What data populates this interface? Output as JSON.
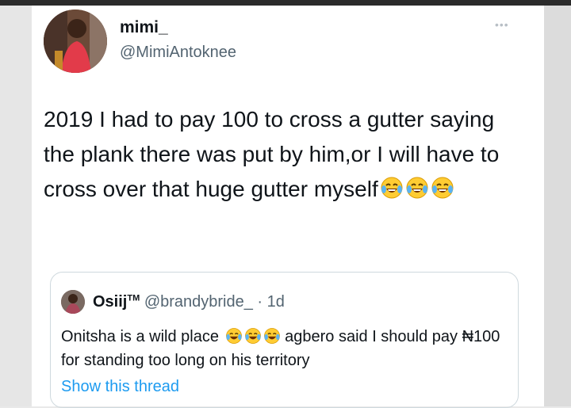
{
  "tweet": {
    "name": "mimi_",
    "handle": "@MimiAntoknee",
    "more_label": "•••",
    "text": "2019 I had to pay 100 to cross a gutter saying the plank there was put by him,or I will have to cross over that huge gutter myself",
    "emoji": [
      "face-with-tears-of-joy",
      "face-with-tears-of-joy",
      "face-with-tears-of-joy"
    ]
  },
  "quoted": {
    "name": "Osiij",
    "name_suffix": "TM",
    "handle": "@brandybride_",
    "separator": " · ",
    "time": "1d",
    "text_before": "Onitsha is a wild place",
    "emoji": [
      "face-with-tears-of-joy",
      "face-with-tears-of-joy",
      "face-with-tears-of-joy"
    ],
    "text_after": "agbero said I should pay ₦100 for standing too long on his territory",
    "show_thread": "Show this thread"
  },
  "colors": {
    "text": "#0f1419",
    "secondary": "#536471",
    "link": "#1d9bf0",
    "border": "#cfd9de"
  }
}
